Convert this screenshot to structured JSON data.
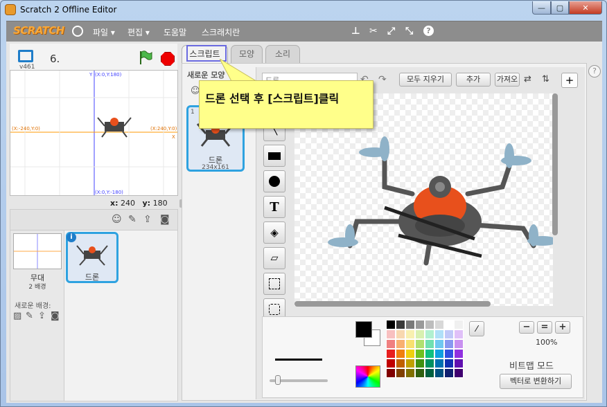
{
  "window": {
    "title": "Scratch 2 Offline Editor",
    "min": "—",
    "max": "▢",
    "close": "✕"
  },
  "menubar": {
    "logo": "SCRATCH",
    "items": [
      "파일 ▾",
      "편집 ▾",
      "도움말",
      "스크래치란"
    ],
    "tools": [
      "copy-stamp-icon",
      "cut-icon",
      "grow-icon",
      "shrink-icon",
      "help-icon"
    ]
  },
  "stage": {
    "version": "v461",
    "number": "6.",
    "coord_labels": {
      "top": "(X:0,Y:180)",
      "bottom": "(X:0,Y:-180)",
      "left": "(X:-240,Y:0)",
      "right": "(X:240,Y:0)",
      "x_axis": "X",
      "y_axis": "Y"
    },
    "mouse": {
      "x_label": "x:",
      "x": "240",
      "y_label": "y:",
      "y": "180"
    }
  },
  "sprites": {
    "stage_name": "무대",
    "stage_backdrops": "2 배경",
    "new_backdrop_label": "새로운 배경:",
    "sprite_name": "드론"
  },
  "tabs": {
    "scripts": "스크립트",
    "costumes": "모양",
    "sounds": "소리"
  },
  "costumes": {
    "new_label": "새로운 모양",
    "items": [
      {
        "index": "1",
        "name": "드론",
        "size": "234x161"
      }
    ]
  },
  "paint": {
    "name_field": "드론",
    "clear": "모두 지우기",
    "add": "추가",
    "import": "가져오기",
    "zoom_level": "100%",
    "mode": "비트맵 모드",
    "convert": "벡터로 변환하기",
    "tools": [
      "brush-icon",
      "line-icon",
      "rectangle-icon",
      "ellipse-icon",
      "text-icon",
      "fill-icon",
      "eraser-icon",
      "select-icon",
      "stamp-select-icon"
    ],
    "fg_color": "#000000",
    "bg_color": "#ffffff",
    "palette": [
      "#000000",
      "#3a3a3a",
      "#7a7a7a",
      "#9a9a9a",
      "#bdbdbd",
      "#d8d8d8",
      "#ffffff",
      "#f0f0f0",
      "#f8c0c0",
      "#f8d8b0",
      "#f8f0b0",
      "#d8f0b0",
      "#b0f0d0",
      "#b0e0f8",
      "#c0c8f8",
      "#e0c0f8",
      "#f08080",
      "#f8b070",
      "#f8e070",
      "#b0e070",
      "#70e0b0",
      "#70c8f0",
      "#8898f0",
      "#c890f0",
      "#e82020",
      "#f08010",
      "#f0d010",
      "#70c020",
      "#10c080",
      "#10a0e0",
      "#3050e0",
      "#9030e0",
      "#c00000",
      "#c06000",
      "#c0a000",
      "#409010",
      "#009060",
      "#0070b0",
      "#1030b0",
      "#6010b0",
      "#800000",
      "#804000",
      "#807000",
      "#306010",
      "#006040",
      "#005080",
      "#102070",
      "#400070"
    ]
  },
  "callout": {
    "text": "드론 선택 후 [스크립트]클릭"
  }
}
